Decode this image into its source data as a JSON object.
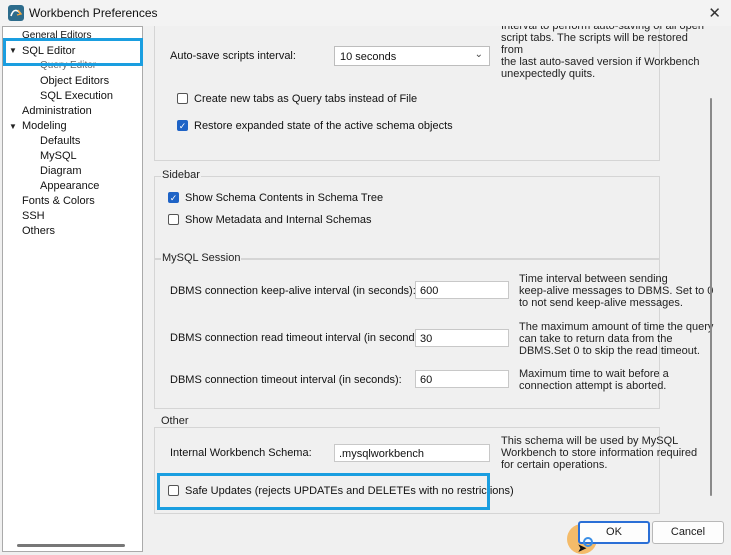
{
  "window": {
    "title": "Workbench Preferences"
  },
  "tree": {
    "items": [
      {
        "label": "General Editors"
      },
      {
        "label": "SQL Editor"
      },
      {
        "label": "Query Editor"
      },
      {
        "label": "Object Editors"
      },
      {
        "label": "SQL Execution"
      },
      {
        "label": "Administration"
      },
      {
        "label": "Modeling"
      },
      {
        "label": "Defaults"
      },
      {
        "label": "MySQL"
      },
      {
        "label": "Diagram"
      },
      {
        "label": "Appearance"
      },
      {
        "label": "Fonts & Colors"
      },
      {
        "label": "SSH"
      },
      {
        "label": "Others"
      }
    ]
  },
  "top": {
    "help_partial": "Interval to perform auto-saving of all open\nscript tabs. The scripts will be restored from\nthe last auto-saved version if Workbench\nunexpectedly quits.",
    "autosave_label": "Auto-save scripts interval:",
    "autosave_value": "10 seconds",
    "new_tabs_label": "Create new tabs as Query tabs instead of File",
    "new_tabs_checked": false,
    "restore_label": "Restore expanded state of the active schema objects",
    "restore_checked": true
  },
  "sidebar": {
    "title": "Sidebar",
    "show_schema_label": "Show Schema Contents in Schema Tree",
    "show_schema_checked": true,
    "show_metadata_label": "Show Metadata and Internal Schemas",
    "show_metadata_checked": false
  },
  "session": {
    "title": "MySQL Session",
    "keepalive_label": "DBMS connection keep-alive interval (in seconds):",
    "keepalive_value": "600",
    "keepalive_help": "Time interval between sending\nkeep-alive messages to DBMS. Set to 0\nto not send keep-alive messages.",
    "read_timeout_label": "DBMS connection read timeout interval (in seconds):",
    "read_timeout_value": "30",
    "read_timeout_help": "The maximum amount of time the query\ncan take to return data from the\nDBMS.Set 0 to skip the read timeout.",
    "conn_timeout_label": "DBMS connection timeout interval (in seconds):",
    "conn_timeout_value": "60",
    "conn_timeout_help": "Maximum time to wait before a\nconnection attempt is aborted."
  },
  "other": {
    "title": "Other",
    "schema_label": "Internal Workbench Schema:",
    "schema_value": ".mysqlworkbench",
    "schema_help": "This schema will be used by MySQL\nWorkbench to store information required\nfor certain operations.",
    "safe_updates_label": "Safe Updates (rejects UPDATEs and DELETEs with no restrictions)",
    "safe_updates_checked": false
  },
  "buttons": {
    "ok": "OK",
    "cancel": "Cancel"
  },
  "colors": {
    "highlight": "#1a9ee0",
    "checkbox_accent": "#1e63c6",
    "ok_border": "#2a6fd6"
  }
}
